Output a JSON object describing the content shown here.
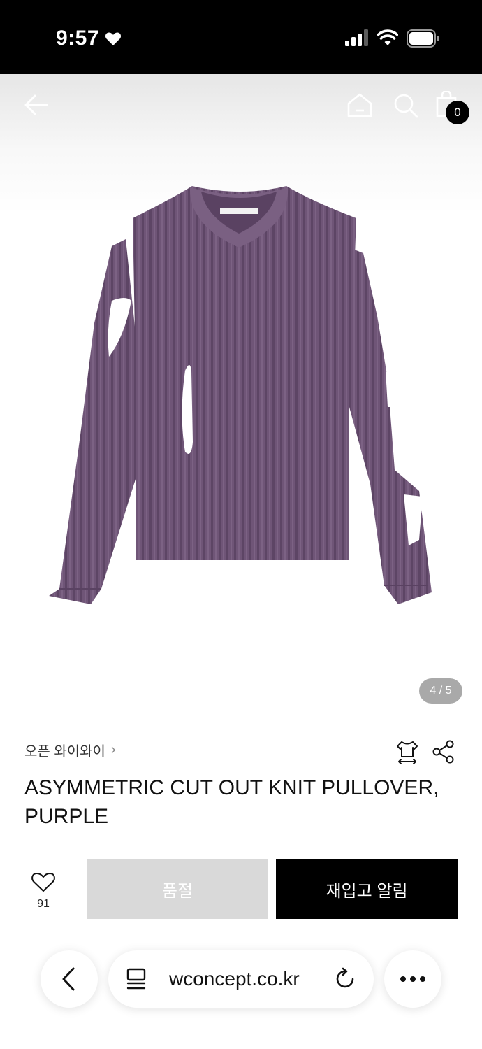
{
  "status_bar": {
    "time": "9:57"
  },
  "header": {
    "cart_count": "0",
    "icons": [
      "back-arrow-icon",
      "home-icon",
      "search-icon",
      "shopping-bag-icon"
    ]
  },
  "gallery": {
    "pager": "4 / 5",
    "image_color": "#6f5577"
  },
  "product": {
    "brand": "오픈 와이와이",
    "brand_chevron": "›",
    "title": "ASYMMETRIC CUT OUT KNIT PULLOVER, PURPLE"
  },
  "actions": {
    "wish_count": "91",
    "soldout_label": "품절",
    "notify_label": "재입고 알림"
  },
  "browser": {
    "url": "wconcept.co.kr"
  },
  "colors": {
    "accent": "#000000",
    "disabled": "#d9d9d9"
  }
}
